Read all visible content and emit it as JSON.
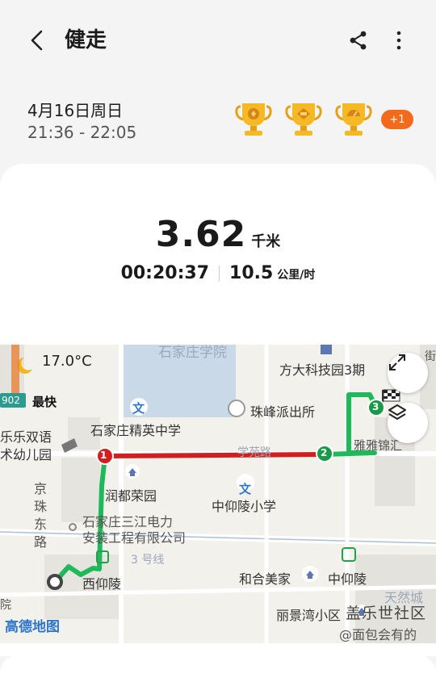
{
  "header": {
    "title": "健走"
  },
  "session": {
    "date": "4月16日周日",
    "time_range": "21:36 - 22:05",
    "extra_badges": "+1"
  },
  "summary": {
    "distance": "3.62",
    "distance_unit": "千米",
    "duration": "00:20:37",
    "speed": "10.5",
    "speed_unit": "公里/时"
  },
  "map": {
    "temperature": "17.0°C",
    "fastest_label": "最快",
    "sign_value": "902",
    "provider": "高德地图",
    "labels": {
      "shijiazhuang_college": "石家庄学院",
      "fangda_park": "方大科技园3期",
      "zhufeng_police": "珠峰派出所",
      "jingying_school": "石家庄精英中学",
      "lexue_kindergarten_1": "乐乐双语",
      "lexue_kindergarten_2": "术幼儿园",
      "xueyuan_road": "学苑路",
      "zhongyangling_school": "中仰陵小学",
      "rundu_garden": "润都荣园",
      "jingzhu_road_1": "京",
      "jingzhu_road_2": "珠",
      "jingzhu_road_3": "东",
      "jingzhu_road_4": "路",
      "sanjiang_1": "石家庄三江电力",
      "sanjiang_2": "安装工程有限公司",
      "line3": "3 号线",
      "xiyangling": "西仰陵",
      "hehe_meijia": "和合美家",
      "zhongyangling": "中仰陵",
      "lijingwan": "丽景湾小区",
      "tianran": "天然城",
      "yayuan": "雅雅锦汇",
      "edge_left": "院",
      "edge_right": "街"
    },
    "markers": [
      "1",
      "2",
      "3"
    ]
  },
  "watermark": {
    "line1": "盖乐世社区",
    "line2": "@面包会有的"
  },
  "colors": {
    "route_fast": "#1fb85a",
    "route_slow": "#d21e1e",
    "badge": "#f26a1b",
    "map_bg": "#f3f1ec",
    "campus": "#c9d9e8"
  }
}
